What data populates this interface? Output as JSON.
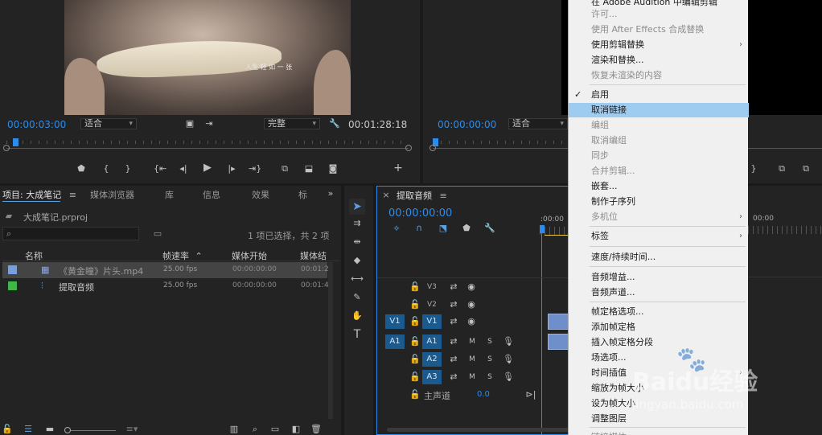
{
  "source_monitor": {
    "timecode": "00:00:03:00",
    "fit_label": "适合",
    "quality_label": "完整",
    "duration": "00:01:28:18",
    "subtitle_text": "人生  轻  如  一  张"
  },
  "program_monitor": {
    "timecode": "00:00:00:00",
    "fit_label": "适合"
  },
  "project_panel": {
    "tabs": [
      "项目: 大成笔记",
      "媒体浏览器",
      "库",
      "信息",
      "效果",
      "标"
    ],
    "project_file": "大成笔记.prproj",
    "selection_status": "1 项已选择，共 2 项",
    "columns": [
      "名称",
      "帧速率",
      "媒体开始",
      "媒体结"
    ],
    "rows": [
      {
        "name": "《黄金瞳》片头.mp4",
        "fps": "25.00 fps",
        "start": "00:00:00:00",
        "end": "00:01:2",
        "color": "#7a9fd6"
      },
      {
        "name": "提取音频",
        "fps": "25.00 fps",
        "start": "00:00:00:00",
        "end": "00:01:4",
        "color": "#3fb64a"
      }
    ]
  },
  "timeline": {
    "tab_label": "提取音频",
    "timecode": "00:00:00:00",
    "ruler_start": ":00:00",
    "ruler_end": "00:00",
    "video_tracks": [
      "V3",
      "V2",
      "V1"
    ],
    "audio_tracks": [
      "A1",
      "A2",
      "A3"
    ],
    "source_v": "V1",
    "source_a": "A1",
    "mute_label": "M",
    "solo_label": "S",
    "master_label": "主声道",
    "master_value": "0.0"
  },
  "context_menu": {
    "items": [
      {
        "label": "在 Adobe Audition 中编辑剪辑",
        "disabled": false,
        "partial": true
      },
      {
        "label": "许可...",
        "disabled": true
      },
      {
        "label": "使用 After Effects 合成替换",
        "disabled": true
      },
      {
        "label": "使用剪辑替换",
        "disabled": false,
        "submenu": true
      },
      {
        "label": "渲染和替换...",
        "disabled": false
      },
      {
        "label": "恢复未渲染的内容",
        "disabled": true
      },
      {
        "sep": true
      },
      {
        "label": "启用",
        "disabled": false,
        "checked": true
      },
      {
        "label": "取消链接",
        "disabled": false,
        "highlight": true
      },
      {
        "label": "编组",
        "disabled": true
      },
      {
        "label": "取消编组",
        "disabled": true
      },
      {
        "label": "同步",
        "disabled": true
      },
      {
        "label": "合并剪辑...",
        "disabled": true
      },
      {
        "label": "嵌套...",
        "disabled": false
      },
      {
        "label": "制作子序列",
        "disabled": false
      },
      {
        "label": "多机位",
        "disabled": true,
        "submenu": true
      },
      {
        "sep": true
      },
      {
        "label": "标签",
        "disabled": false,
        "submenu": true
      },
      {
        "sep": true
      },
      {
        "label": "速度/持续时间...",
        "disabled": false
      },
      {
        "sep": true
      },
      {
        "label": "音频增益...",
        "disabled": false
      },
      {
        "label": "音频声道...",
        "disabled": false
      },
      {
        "sep": true
      },
      {
        "label": "帧定格选项...",
        "disabled": false
      },
      {
        "label": "添加帧定格",
        "disabled": false
      },
      {
        "label": "插入帧定格分段",
        "disabled": false
      },
      {
        "label": "场选项...",
        "disabled": false
      },
      {
        "label": "时间插值",
        "disabled": false,
        "submenu": true
      },
      {
        "label": "缩放为帧大小",
        "disabled": false
      },
      {
        "label": "设为帧大小",
        "disabled": false
      },
      {
        "label": "调整图层",
        "disabled": false
      },
      {
        "sep": true
      },
      {
        "label": "链接媒体...",
        "disabled": true,
        "partial": true
      }
    ]
  },
  "watermark": {
    "brand": "Baidu经验",
    "url": "jingyan.baidu.com"
  }
}
